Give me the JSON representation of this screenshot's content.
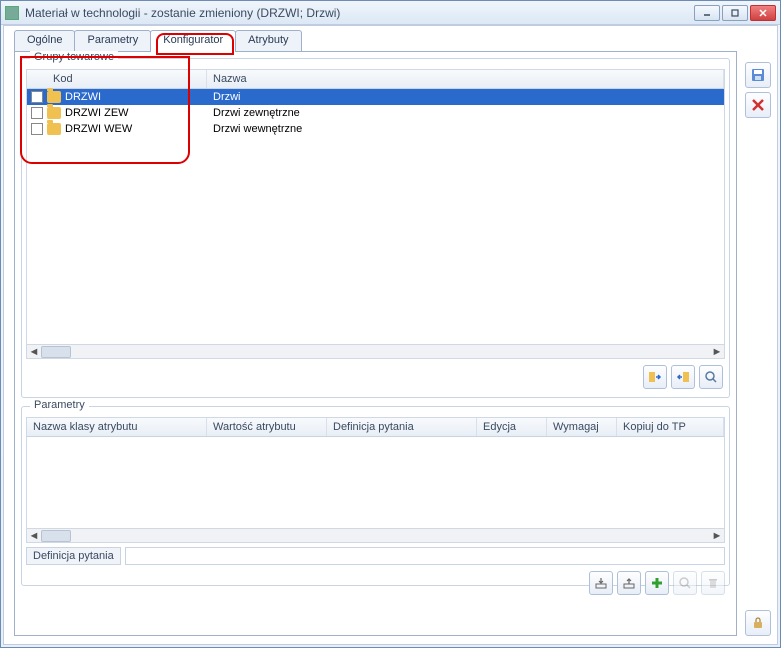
{
  "window": {
    "title": "Materiał w technologii - zostanie zmieniony  (DRZWI; Drzwi)"
  },
  "tabs": {
    "general": "Ogólne",
    "parameters": "Parametry",
    "configurator": "Konfigurator",
    "attributes": "Atrybuty"
  },
  "group1": {
    "legend": "Grupy towarowe",
    "col_kod": "Kod",
    "col_nazwa": "Nazwa",
    "rows": [
      {
        "kod": "DRZWI",
        "nazwa": "Drzwi",
        "selected": true
      },
      {
        "kod": "DRZWI ZEW",
        "nazwa": "Drzwi zewnętrzne",
        "selected": false
      },
      {
        "kod": "DRZWI WEW",
        "nazwa": "Drzwi wewnętrzne",
        "selected": false
      }
    ]
  },
  "group2": {
    "legend": "Parametry",
    "cols": {
      "c1": "Nazwa klasy atrybutu",
      "c2": "Wartość atrybutu",
      "c3": "Definicja pytania",
      "c4": "Edycja",
      "c5": "Wymagaj",
      "c6": "Kopiuj do TP"
    }
  },
  "def_label": "Definicja pytania",
  "icons": {
    "save": "save-icon",
    "close": "close-icon",
    "lock": "lock-icon"
  }
}
